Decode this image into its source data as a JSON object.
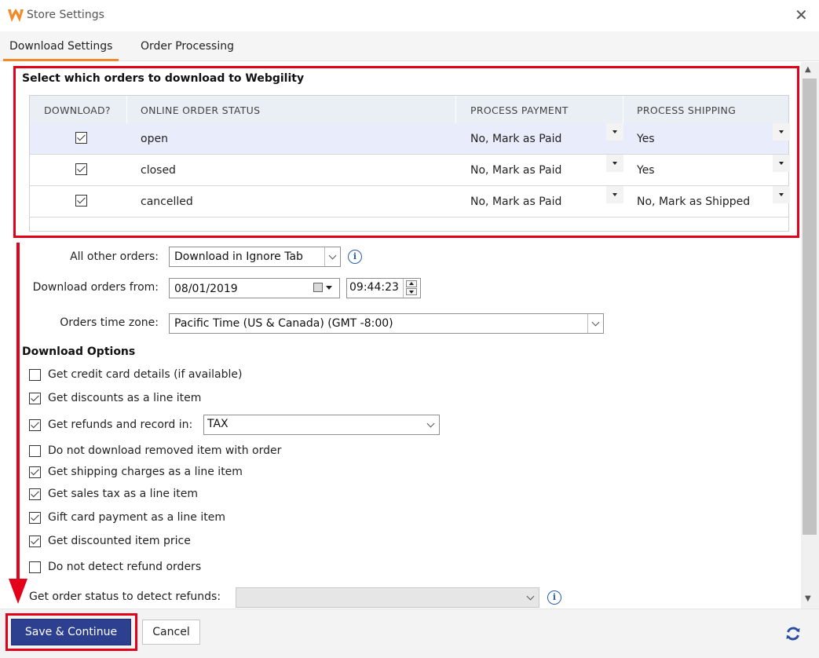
{
  "window": {
    "title": "Store Settings"
  },
  "tabs": [
    {
      "label": "Download Settings",
      "active": true
    },
    {
      "label": "Order Processing",
      "active": false
    }
  ],
  "orders_section": {
    "title": "Select which orders to download to Webgility",
    "columns": [
      "DOWNLOAD?",
      "ONLINE ORDER STATUS",
      "PROCESS PAYMENT",
      "PROCESS SHIPPING"
    ],
    "rows": [
      {
        "download": true,
        "status": "open",
        "payment": "No, Mark as Paid",
        "shipping": "Yes"
      },
      {
        "download": true,
        "status": "closed",
        "payment": "No, Mark as Paid",
        "shipping": "Yes"
      },
      {
        "download": true,
        "status": "cancelled",
        "payment": "No, Mark as Paid",
        "shipping": "No, Mark as Shipped"
      }
    ]
  },
  "fields": {
    "all_other_orders_label": "All other orders:",
    "all_other_orders_value": "Download in Ignore Tab",
    "download_from_label": "Download orders from:",
    "download_from_date": "08/01/2019",
    "download_from_time": "09:44:23",
    "timezone_label": "Orders time zone:",
    "timezone_value": "Pacific Time (US & Canada) (GMT -8:00)"
  },
  "download_options": {
    "title": "Download Options",
    "options": [
      {
        "label": "Get credit card details (if available)",
        "checked": false
      },
      {
        "label": "Get discounts as a line item",
        "checked": true
      },
      {
        "label": "Get refunds and record in:",
        "checked": true
      },
      {
        "label": "Do not download removed item with order",
        "checked": false
      },
      {
        "label": "Get shipping charges as a line item",
        "checked": true
      },
      {
        "label": "Get sales tax as a line item",
        "checked": true
      },
      {
        "label": "Gift card payment as a line item",
        "checked": true
      },
      {
        "label": "Get discounted item price",
        "checked": true
      },
      {
        "label": "Do not detect refund orders",
        "checked": false
      }
    ],
    "refunds_record_in": "TAX",
    "refund_status_label": "Get order status to detect refunds:",
    "refund_status_value": ""
  },
  "buttons": {
    "save": "Save & Continue",
    "cancel": "Cancel"
  },
  "colors": {
    "accent_tab": "#f08a2a",
    "primary_button": "#2d3f8f",
    "highlight_red": "#e3001b",
    "selected_row": "#e8ecfb",
    "header_row": "#e9eff5"
  },
  "icons": [
    "webgility-logo-icon",
    "close-icon",
    "info-icon",
    "calendar-icon",
    "refresh-icon"
  ]
}
